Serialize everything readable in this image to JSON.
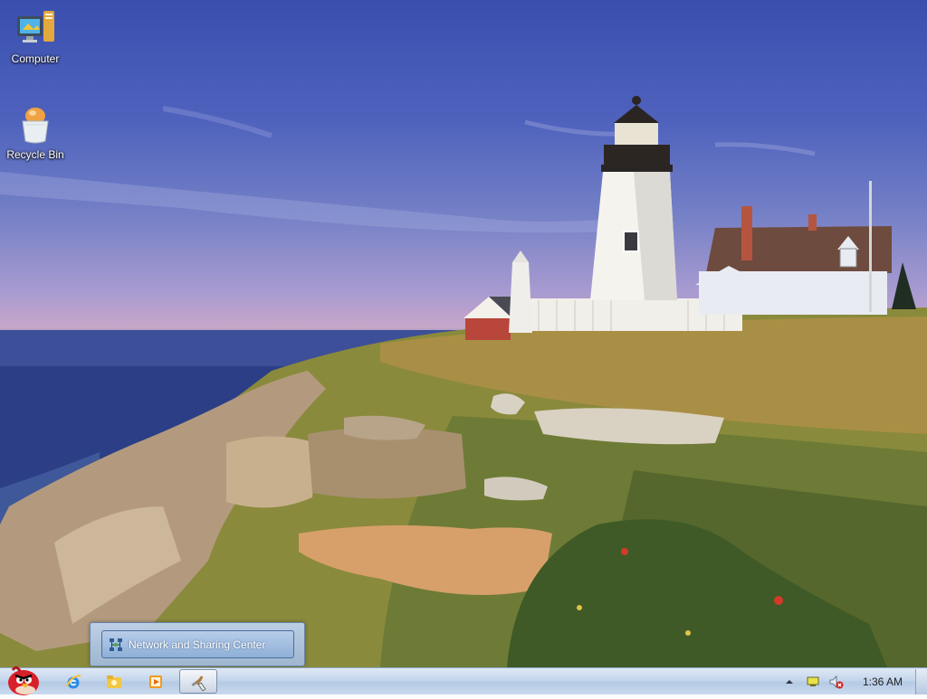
{
  "desktop": {
    "icons": [
      {
        "label": "Computer",
        "icon": "computer-icon"
      },
      {
        "label": "Recycle Bin",
        "icon": "recycle-bin-icon"
      }
    ],
    "wallpaper": "lighthouse-coast"
  },
  "popup": {
    "item_label": "Network and Sharing Center",
    "item_icon": "network-icon"
  },
  "taskbar": {
    "pinned": [
      {
        "icon": "internet-explorer-icon"
      },
      {
        "icon": "file-explorer-icon"
      },
      {
        "icon": "media-player-icon"
      },
      {
        "icon": "control-panel-icon",
        "active": true
      }
    ],
    "tray": {
      "icons": [
        "show-hidden-icons-arrow",
        "action-center-icon",
        "volume-muted-icon"
      ],
      "clock": "1:36 AM"
    }
  },
  "colors": {
    "taskbar": "#c4d6ec",
    "sky": "#4e62bd",
    "popup_highlight": "#8fb0d8"
  }
}
